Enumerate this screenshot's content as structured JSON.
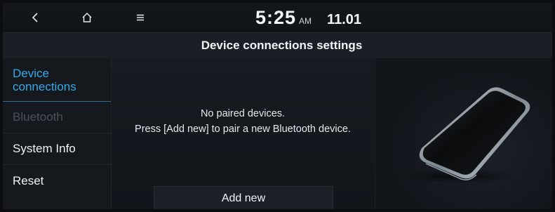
{
  "status_bar": {
    "back_icon": "chevron-left-icon",
    "home_icon": "home-icon",
    "menu_icon": "hamburger-menu-icon",
    "time": "5:25",
    "ampm": "AM",
    "date": "11.01"
  },
  "title": "Device connections settings",
  "sidebar": {
    "items": [
      {
        "label": "Device connections",
        "state": "selected"
      },
      {
        "label": "Bluetooth",
        "state": "disabled"
      },
      {
        "label": "System Info",
        "state": "normal"
      },
      {
        "label": "Reset",
        "state": "normal"
      }
    ]
  },
  "main": {
    "message_line1": "No paired devices.",
    "message_line2": "Press [Add new] to pair a new Bluetooth device.",
    "add_button_label": "Add new"
  },
  "illustration": {
    "icon": "smartphone-illustration"
  },
  "colors": {
    "accent": "#39a8e6",
    "disabled": "#4b525a",
    "background": "#111419"
  }
}
